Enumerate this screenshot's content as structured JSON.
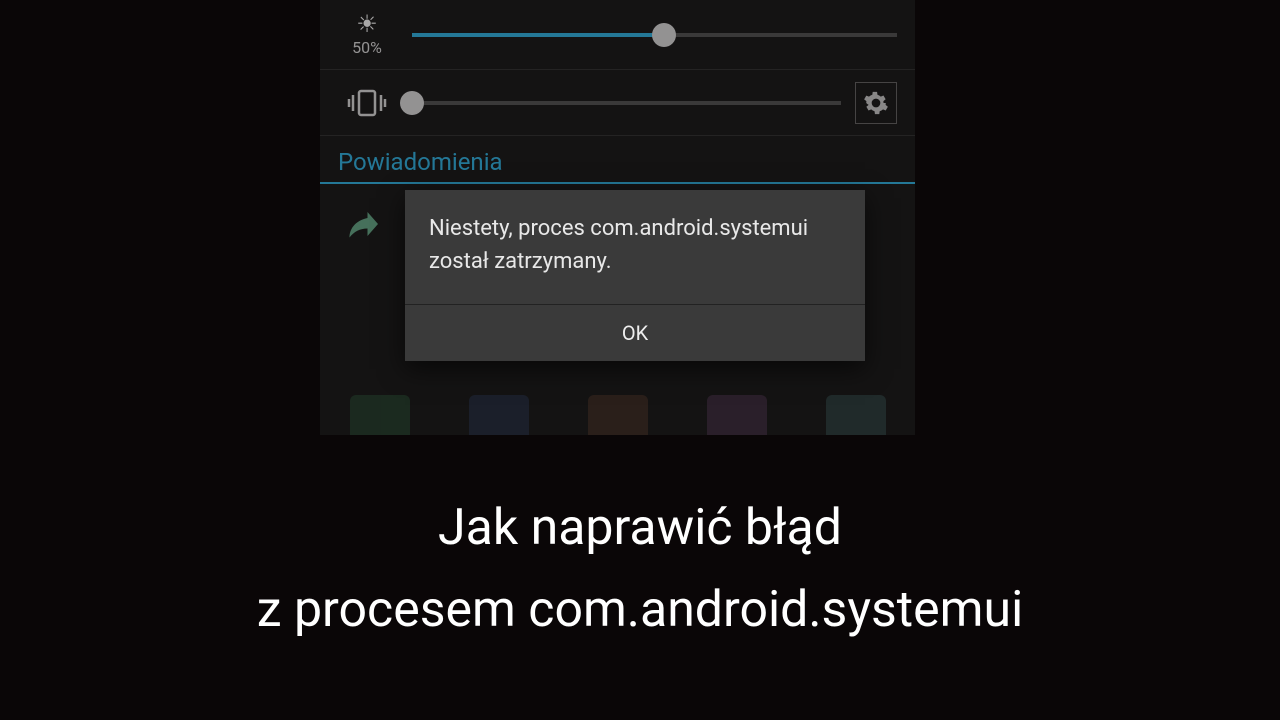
{
  "brightness": {
    "percent_label": "50%",
    "value_pct": 52
  },
  "notifications": {
    "header": "Powiadomienia"
  },
  "dialog": {
    "message": "Niestety, proces com.android.systemui został zatrzymany.",
    "ok": "OK"
  },
  "caption": {
    "line1": "Jak naprawić błąd",
    "line2": "z procesem com.android.systemui"
  }
}
